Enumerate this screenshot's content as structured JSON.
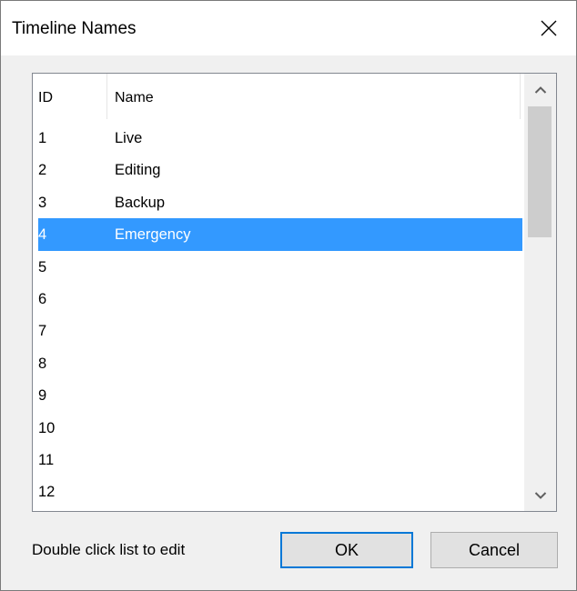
{
  "window": {
    "title": "Timeline Names"
  },
  "list": {
    "columns": {
      "id": "ID",
      "name": "Name"
    },
    "rows": [
      {
        "id": "1",
        "name": "Live"
      },
      {
        "id": "2",
        "name": "Editing"
      },
      {
        "id": "3",
        "name": "Backup"
      },
      {
        "id": "4",
        "name": "Emergency",
        "selected": true
      },
      {
        "id": "5",
        "name": ""
      },
      {
        "id": "6",
        "name": ""
      },
      {
        "id": "7",
        "name": ""
      },
      {
        "id": "8",
        "name": ""
      },
      {
        "id": "9",
        "name": ""
      },
      {
        "id": "10",
        "name": ""
      },
      {
        "id": "11",
        "name": ""
      },
      {
        "id": "12",
        "name": ""
      }
    ]
  },
  "footer": {
    "hint": "Double click list to edit",
    "ok_label": "OK",
    "cancel_label": "Cancel"
  },
  "colors": {
    "selection": "#3399ff",
    "focus_border": "#0078d7"
  },
  "icons": {
    "close": "close-icon",
    "scroll_up": "chevron-up-icon",
    "scroll_down": "chevron-down-icon"
  }
}
